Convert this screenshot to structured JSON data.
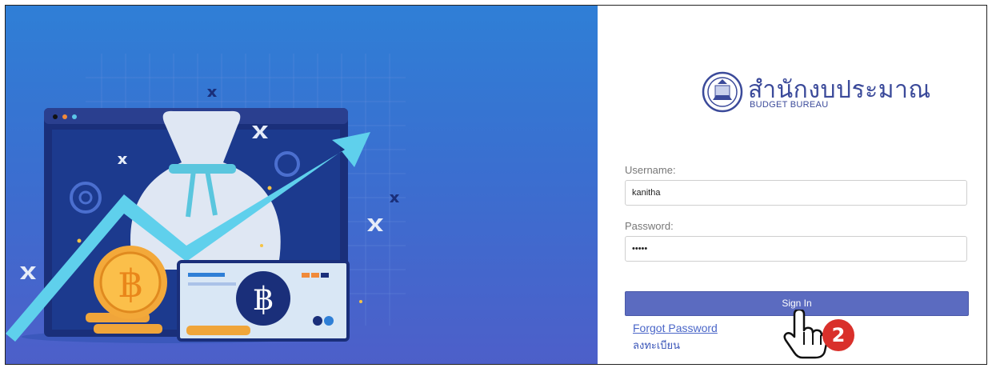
{
  "brand": {
    "title_thai": "สำนักงบประมาณ",
    "subtitle": "BUDGET BUREAU"
  },
  "form": {
    "username_label": "Username:",
    "username_value": "kanitha",
    "password_label": "Password:",
    "password_value": "•••••",
    "signin_label": "Sign In",
    "forgot_link": "Forgot Password",
    "register_link": "ลงทะเบียน"
  },
  "annotation": {
    "step_number": "2"
  },
  "illustration": {
    "currency_symbol": "฿",
    "icons": [
      "money-bag-icon",
      "coin-icon",
      "banknote-icon",
      "growth-arrow-icon",
      "browser-window-icon"
    ]
  },
  "colors": {
    "left_bg": "#3a6fd0",
    "signin_bg": "#5b6bc0",
    "badge": "#d9302b",
    "brand": "#3b4a9a"
  }
}
